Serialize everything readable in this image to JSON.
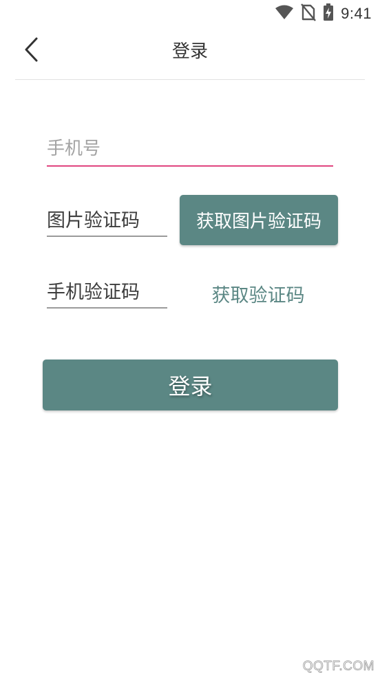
{
  "status_bar": {
    "time": "9:41",
    "icons": [
      "wifi-icon",
      "no-sim-icon",
      "battery-charging-icon"
    ]
  },
  "header": {
    "back_icon": "chevron-left-icon",
    "title": "登录"
  },
  "form": {
    "phone_placeholder": "手机号",
    "captcha_placeholder": "图片验证码",
    "captcha_button_label": "获取图片验证码",
    "sms_placeholder": "手机验证码",
    "sms_button_label": "获取验证码",
    "login_button_label": "登录"
  },
  "colors": {
    "accent": "#5b8784",
    "focus_underline": "#e0457f"
  },
  "watermark": {
    "text": "QQTF.COM"
  }
}
